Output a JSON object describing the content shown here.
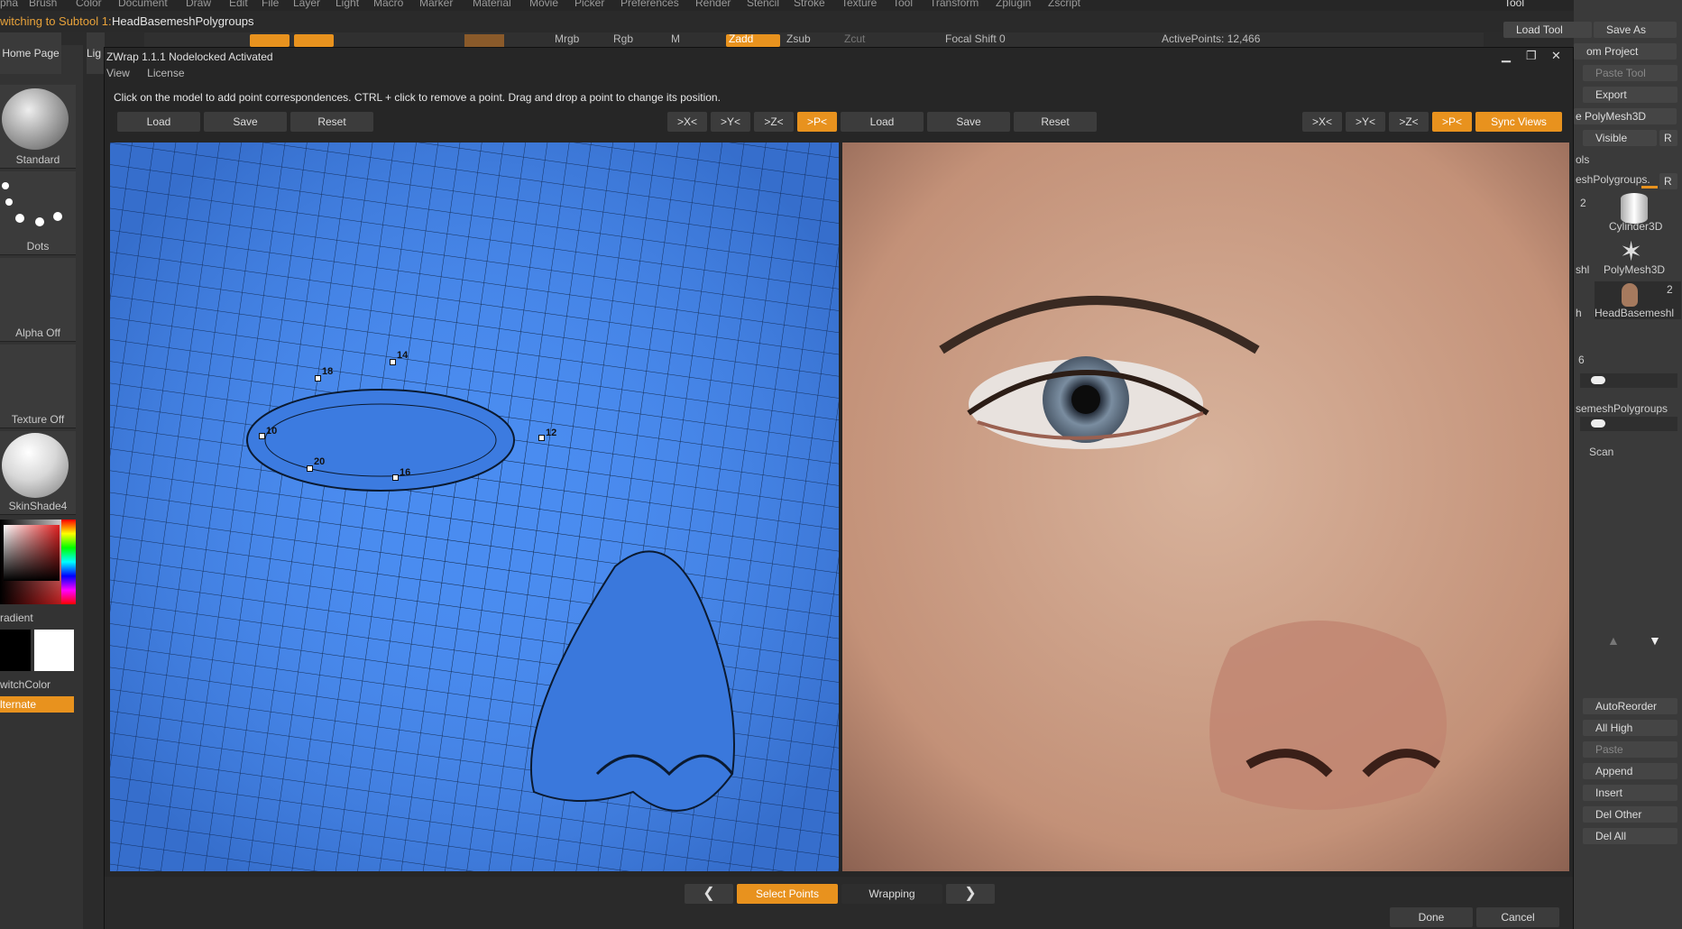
{
  "menubar": {
    "items": [
      "pha",
      "Brush",
      "Color",
      "Document",
      "Draw",
      "Edit",
      "File",
      "Layer",
      "Light",
      "Macro",
      "Marker",
      "Material",
      "Movie",
      "Picker",
      "Preferences",
      "Render",
      "Stencil",
      "Stroke",
      "Texture",
      "Tool",
      "Transform",
      "Zplugin",
      "Zscript"
    ],
    "tool_title": "Tool"
  },
  "infobar": {
    "subtool_label": "witching to Subtool 1:",
    "subtool_name": "HeadBasemeshPolygroups"
  },
  "toolstrip": {
    "mrgb": "Mrgb",
    "rgb": "Rgb",
    "m": "M",
    "zadd": "Zadd",
    "zsub": "Zsub",
    "zcut": "Zcut",
    "focal_shift": "Focal Shift 0",
    "active_points": "ActivePoints: 12,466"
  },
  "leftshelf": {
    "home_page": "Home Page",
    "light_box": "Lig",
    "brush": "Standard",
    "stroke": "Dots",
    "alpha": "Alpha Off",
    "texture": "Texture Off",
    "material": "SkinShade4",
    "gradient": "radient",
    "switch_color": "witchColor",
    "alternate": "lternate"
  },
  "rightpanel": {
    "load_tool": "Load Tool",
    "save_as": "Save As",
    "from_project": "om Project",
    "paste_tool": "Paste Tool",
    "export": "Export",
    "polymesh3d": "e PolyMesh3D",
    "visible": "Visible",
    "r": "R",
    "tools": "ols",
    "subtool_name": "eshPolygroups.",
    "r2": "R",
    "count_a": "2",
    "cylinder": "Cylinder3D",
    "sh": "shl",
    "polymesh": "PolyMesh3D",
    "h": "h",
    "count_b": "2",
    "headbase": "HeadBasemeshl",
    "subtool_count": "6",
    "subtool_item": "semeshPolygroups",
    "scan": "Scan",
    "autoreorder": "AutoReorder",
    "all_high": "All High",
    "paste": "Paste",
    "append": "Append",
    "insert": "Insert",
    "del_other": "Del Other",
    "del_all": "Del All"
  },
  "dialog": {
    "title": "ZWrap 1.1.1  Nodelocked Activated",
    "menu": [
      "View",
      "License"
    ],
    "instructions": "Click on the model to add point correspondences. CTRL + click to remove a point. Drag and drop a point to change its position.",
    "left": {
      "load": "Load",
      "save": "Save",
      "reset": "Reset",
      "x": ">X<",
      "y": ">Y<",
      "z": ">Z<",
      "p": ">P<"
    },
    "right": {
      "load": "Load",
      "save": "Save",
      "reset": "Reset",
      "x": ">X<",
      "y": ">Y<",
      "z": ">Z<",
      "p": ">P<",
      "sync": "Sync Views"
    },
    "points": [
      "14",
      "18",
      "10",
      "12",
      "20",
      "16"
    ],
    "bottom": {
      "select_points": "Select Points",
      "wrapping": "Wrapping",
      "done": "Done",
      "cancel": "Cancel"
    }
  },
  "icons": [
    "minimize-icon",
    "restore-icon",
    "close-icon",
    "chevron-left-icon",
    "chevron-right-icon",
    "arrow-up-icon",
    "arrow-down-icon"
  ],
  "colors": {
    "accent": "#e8921e",
    "mesh_blue": "#4a8cf0"
  }
}
